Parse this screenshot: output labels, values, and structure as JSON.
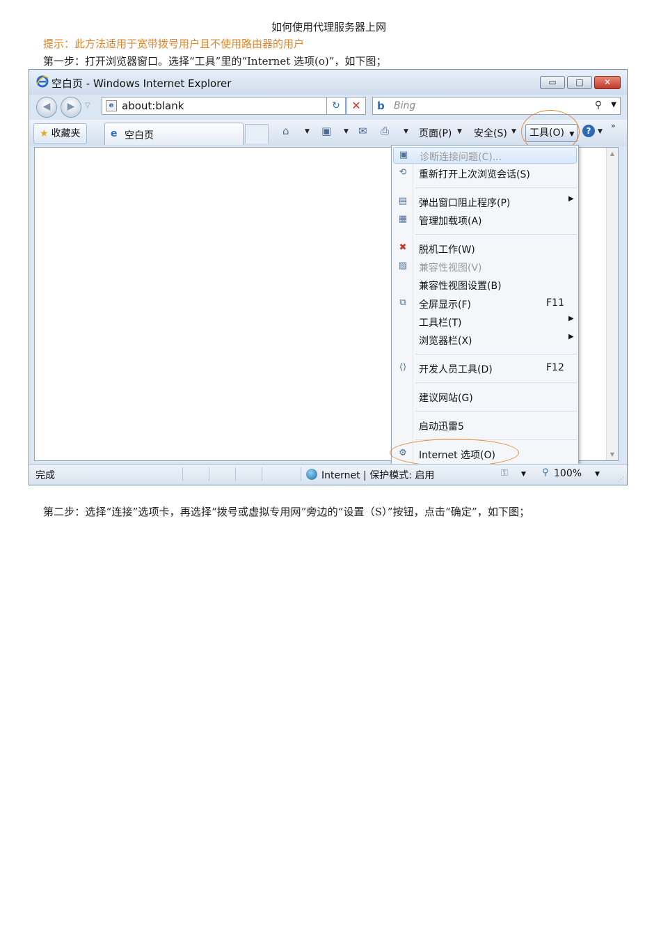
{
  "document": {
    "title": "如何使用代理服务器上网",
    "tip": "提示：此方法适用于宽带拨号用户且不使用路由器的用户",
    "step1": "第一步：打开浏览器窗口。选择“工具”里的“Internet 选项(o)”，如下图；",
    "step2": "第二步：选择“连接”选项卡，再选择“拨号或虚拟专用网”旁边的“设置（S）”按钮，点击“确定”，如下图；"
  },
  "browser": {
    "window_title": "空白页 - Windows Internet Explorer",
    "address": "about:blank",
    "search_placeholder": "Bing",
    "favorites_label": "收藏夹",
    "tab_label": "空白页",
    "commands": {
      "page": "页面(P)",
      "safety": "安全(S)",
      "tools": "工具(O)"
    },
    "tools_menu": [
      {
        "label": "诊断连接问题(C)...",
        "icon": "diagnose-icon",
        "disabled": true
      },
      {
        "label": "重新打开上次浏览会话(S)",
        "icon": "reopen-icon"
      },
      {
        "label": "弹出窗口阻止程序(P)",
        "icon": "popup-blocker-icon",
        "submenu": true
      },
      {
        "label": "管理加载项(A)",
        "icon": "addons-icon"
      },
      {
        "label": "脱机工作(W)",
        "icon": "offline-icon"
      },
      {
        "label": "兼容性视图(V)",
        "icon": "compat-view-icon",
        "disabled": true
      },
      {
        "label": "兼容性视图设置(B)"
      },
      {
        "label": "全屏显示(F)",
        "shortcut": "F11",
        "icon": "fullscreen-icon"
      },
      {
        "label": "工具栏(T)",
        "submenu": true
      },
      {
        "label": "浏览器栏(X)",
        "submenu": true
      },
      {
        "label": "开发人员工具(D)",
        "shortcut": "F12",
        "icon": "dev-tools-icon"
      },
      {
        "label": "建议网站(G)"
      },
      {
        "label": "启动迅雷5"
      },
      {
        "label": "Internet 选项(O)",
        "icon": "internet-options-icon"
      }
    ],
    "status": {
      "text": "完成",
      "zone": "Internet | 保护模式: 启用",
      "zoom": "100%"
    },
    "colors": {
      "annotation_ellipse": "#e58b3c",
      "tip_text": "#e0852a"
    }
  }
}
